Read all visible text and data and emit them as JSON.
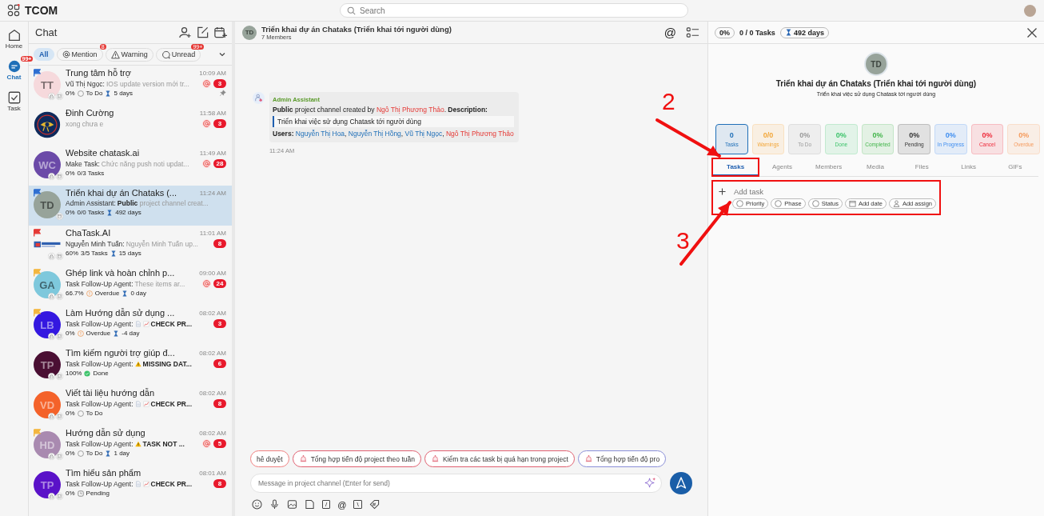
{
  "app": {
    "name": "TCOM",
    "search_placeholder": "Search"
  },
  "rail": [
    {
      "label": "Home",
      "kind": "home",
      "selected": false
    },
    {
      "label": "Chat",
      "kind": "chat",
      "selected": true,
      "badge": "99+"
    },
    {
      "label": "Task",
      "kind": "task",
      "selected": false
    }
  ],
  "chat_list": {
    "title": "Chat",
    "filters": [
      {
        "label": "All",
        "kind": "none",
        "selected": true
      },
      {
        "label": "Mention",
        "kind": "at",
        "selected": false,
        "badge": "8"
      },
      {
        "label": "Warning",
        "kind": "warning",
        "selected": false
      },
      {
        "label": "Unread",
        "kind": "unread",
        "selected": false,
        "badge": "99+"
      }
    ],
    "items": [
      {
        "name": "Trung tâm hỗ trợ",
        "time": "10:09 AM",
        "avatar": {
          "kind": "initials",
          "initials": "TT",
          "color": "#f6d9dc",
          "dark": false
        },
        "flag": {
          "color": "#2f6fd1"
        },
        "badges": [
          {
            "kind": "lock"
          },
          {
            "kind": "check"
          }
        ],
        "sender": "Vũ Thị Ngọc:",
        "preview": "IOS update version mới tr...",
        "meta": {
          "percent": "0%",
          "status": {
            "kind": "todo",
            "label": "To Do"
          },
          "days": "5 days"
        },
        "mention": true,
        "unread": "3",
        "pinned": true,
        "selected": false
      },
      {
        "name": "Đinh Cường",
        "time": "11:58 AM",
        "avatar": {
          "kind": "picture"
        },
        "preview": "xong chưa e",
        "mention": true,
        "unread": "3",
        "pinned": false,
        "selected": false
      },
      {
        "name": "Website chatask.ai",
        "time": "11:49 AM",
        "avatar": {
          "kind": "initials",
          "initials": "WC",
          "color": "#6b4aa8",
          "dark": true
        },
        "badges": [
          {
            "kind": "lock"
          },
          {
            "kind": "calendar"
          }
        ],
        "sender": "Make Task:",
        "preview": "Chức năng push noti updat...",
        "meta": {
          "percent": "0%",
          "tasks": "0/3 Tasks"
        },
        "mention": true,
        "unread": "28",
        "pinned": false,
        "selected": false
      },
      {
        "name": "Triển khai dự án Chataks (...",
        "time": "11:24 AM",
        "avatar": {
          "kind": "initials",
          "initials": "TD",
          "color": "#97a39a",
          "dark": false
        },
        "flag": {
          "color": "#2f6fd1"
        },
        "badges": [
          {
            "kind": "calendar"
          }
        ],
        "sender": "Admin Assistant:",
        "preview": "**Public** project channel creat...",
        "meta": {
          "percent": "0%",
          "tasks": "0/0 Tasks",
          "days": "492 days"
        },
        "mention": false,
        "pinned": false,
        "selected": true
      },
      {
        "name": "ChaTask.AI",
        "time": "11:01 AM",
        "avatar": {
          "kind": "logo"
        },
        "flag": {
          "color": "#e53935"
        },
        "badges": [
          {
            "kind": "lock"
          },
          {
            "kind": "calendar"
          }
        ],
        "sender": "Nguyễn Minh Tuấn:",
        "preview": "Nguyễn Minh Tuấn up...",
        "meta": {
          "percent": "60%",
          "tasks": "3/5 Tasks",
          "days": "15 days"
        },
        "mention": false,
        "unread": "8",
        "pinned": false,
        "selected": false
      },
      {
        "name": "Ghép link và hoàn chỉnh p...",
        "time": "09:00 AM",
        "avatar": {
          "kind": "initials",
          "initials": "GA",
          "color": "#7ec8dc",
          "dark": false
        },
        "flag": {
          "color": "#f3b63f"
        },
        "badges": [
          {
            "kind": "lock"
          },
          {
            "kind": "check"
          }
        ],
        "sender": "Task Follow-Up Agent:",
        "preview": "These items ar...",
        "meta": {
          "percent": "66.7%",
          "status": {
            "kind": "overdue",
            "label": "Overdue"
          },
          "days": "0 day"
        },
        "mention": true,
        "unread": "24",
        "pinned": false,
        "selected": false
      },
      {
        "name": "Làm Hướng dẫn sử dụng ...",
        "time": "08:02 AM",
        "avatar": {
          "kind": "initials",
          "initials": "LB",
          "color": "#3418e0",
          "dark": true
        },
        "flag": {
          "color": "#f3b63f"
        },
        "badges": [
          {
            "kind": "lock"
          },
          {
            "kind": "check"
          }
        ],
        "sender": "Task Follow-Up Agent:",
        "preview": "**CHECK PR...**",
        "preview_icons": [
          {
            "kind": "document"
          },
          {
            "kind": "chart"
          }
        ],
        "meta": {
          "percent": "0%",
          "status": {
            "kind": "overdue",
            "label": "Overdue"
          },
          "days": "-4 day"
        },
        "mention": false,
        "unread": "3",
        "pinned": false,
        "selected": false
      },
      {
        "name": "Tìm kiếm người trợ giúp đ...",
        "time": "08:02 AM",
        "avatar": {
          "kind": "initials",
          "initials": "TP",
          "color": "#4a0f33",
          "dark": true
        },
        "badges": [
          {
            "kind": "lock"
          },
          {
            "kind": "check"
          }
        ],
        "sender": "Task Follow-Up Agent:",
        "preview": "**MISSING DAT...**",
        "preview_icons": [
          {
            "kind": "warning"
          }
        ],
        "meta": {
          "percent": "100%",
          "status": {
            "kind": "done",
            "label": "Done"
          }
        },
        "mention": false,
        "unread": "6",
        "pinned": false,
        "selected": false
      },
      {
        "name": "Viết tài liệu hướng dẫn",
        "time": "08:02 AM",
        "avatar": {
          "kind": "initials",
          "initials": "VD",
          "color": "#f4622a",
          "dark": true
        },
        "badges": [
          {
            "kind": "lock"
          },
          {
            "kind": "check"
          }
        ],
        "sender": "Task Follow-Up Agent:",
        "preview": "**CHECK PR...**",
        "preview_icons": [
          {
            "kind": "document"
          },
          {
            "kind": "chart"
          }
        ],
        "meta": {
          "percent": "0%",
          "status": {
            "kind": "todo",
            "label": "To Do"
          }
        },
        "mention": false,
        "unread": "8",
        "pinned": false,
        "selected": false
      },
      {
        "name": "Hướng dẫn sử dụng",
        "time": "08:02 AM",
        "avatar": {
          "kind": "initials",
          "initials": "HD",
          "color": "#a98ab0",
          "dark": true
        },
        "flag": {
          "color": "#f3b63f"
        },
        "badges": [
          {
            "kind": "lock"
          },
          {
            "kind": "check"
          }
        ],
        "sender": "Task Follow-Up Agent:",
        "preview": "**TASK NOT ...**",
        "preview_icons": [
          {
            "kind": "warning"
          }
        ],
        "meta": {
          "percent": "0%",
          "status": {
            "kind": "todo",
            "label": "To Do"
          },
          "days": "1 day"
        },
        "mention": true,
        "unread": "5",
        "pinned": false,
        "selected": false
      },
      {
        "name": "Tìm hiểu sản phẩm",
        "time": "08:01 AM",
        "avatar": {
          "kind": "initials",
          "initials": "TP",
          "color": "#5a12c8",
          "dark": true
        },
        "badges": [
          {
            "kind": "lock"
          },
          {
            "kind": "check"
          }
        ],
        "sender": "Task Follow-Up Agent:",
        "preview": "**CHECK PR...**",
        "preview_icons": [
          {
            "kind": "document"
          },
          {
            "kind": "chart"
          }
        ],
        "meta": {
          "percent": "0%",
          "status": {
            "kind": "pending",
            "label": "Pending"
          }
        },
        "mention": false,
        "unread": "8",
        "pinned": false,
        "selected": false
      }
    ]
  },
  "channel": {
    "initials": "TD",
    "title": "Triển khai dự án Chataks (Triển khai tới người dùng)",
    "members": "7 Members",
    "mention_label": "@"
  },
  "message": {
    "sender": "Admin Assistant",
    "line_1": [
      {
        "kind": "bold",
        "text": "Public"
      },
      {
        "kind": "plain",
        "text": " project channel created by "
      },
      {
        "kind": "red",
        "text": "Ngô Thị Phương Thảo"
      },
      {
        "kind": "plain",
        "text": ". "
      },
      {
        "kind": "bold",
        "text": "Description:"
      }
    ],
    "quote": "Triển khai việc sử dụng Chatask tới người dùng",
    "line_2": [
      {
        "kind": "bold",
        "text": "Users: "
      },
      {
        "kind": "blue",
        "text": "Nguyễn Thị Hoa"
      },
      {
        "kind": "plain",
        "text": ", "
      },
      {
        "kind": "blue",
        "text": "Nguyễn Thị Hồng"
      },
      {
        "kind": "plain",
        "text": ", "
      },
      {
        "kind": "blue",
        "text": "Vũ Thị Ngọc"
      },
      {
        "kind": "plain",
        "text": ", "
      },
      {
        "kind": "red",
        "text": "Ngô Thị Phương Thảo"
      }
    ],
    "time": "11:24 AM"
  },
  "suggestions": [
    {
      "label": "hê duyệt",
      "color": "#f08080",
      "icon": false
    },
    {
      "label": "Tổng hợp tiến độ project theo tuần",
      "color": "#e06070",
      "icon": true
    },
    {
      "label": "Kiểm tra các task bị quá hạn trong project",
      "color": "#e06070",
      "icon": true
    },
    {
      "label": "Tổng hợp tiến độ pro",
      "color": "#8a8fd8",
      "icon": true
    }
  ],
  "composer": {
    "placeholder": "Message in project channel (Enter for send)",
    "tools": [
      {
        "kind": "emoji"
      },
      {
        "kind": "mic"
      },
      {
        "kind": "image"
      },
      {
        "kind": "file"
      },
      {
        "kind": "boxed",
        "label": "/"
      },
      {
        "kind": "text",
        "label": "@"
      },
      {
        "kind": "boxed",
        "label": "\\"
      },
      {
        "kind": "tag"
      }
    ]
  },
  "details": {
    "percent": "0%",
    "tasks": "0 / 0 Tasks",
    "days": "492 days",
    "initials": "TD",
    "title": "Triển khai dự án Chataks (Triển khai tới người dùng)",
    "description": "Triển khai việc sử dụng Chatask tới người dùng",
    "stats": [
      {
        "value": "0",
        "label": "Tasks",
        "color": "#1f6fb8",
        "selected": true
      },
      {
        "value": "0/0",
        "label": "Warnings",
        "color": "#f3a73a",
        "selected": false
      },
      {
        "value": "0%",
        "label": "To Do",
        "color": "#999999",
        "selected": false
      },
      {
        "value": "0%",
        "label": "Done",
        "color": "#3cc36a",
        "selected": false
      },
      {
        "value": "0%",
        "label": "Completed",
        "color": "#42b54a",
        "selected": false
      },
      {
        "value": "0%",
        "label": "Pending",
        "color": "#333333",
        "selected": false
      },
      {
        "value": "0%",
        "label": "In Progress",
        "color": "#3f8ef0",
        "selected": false
      },
      {
        "value": "0%",
        "label": "Cancel",
        "color": "#ee2a3a",
        "selected": false
      },
      {
        "value": "0%",
        "label": "Overdue",
        "color": "#f59a5c",
        "selected": false
      }
    ],
    "tabs": [
      {
        "label": "Tasks",
        "selected": true,
        "highlighted": true
      },
      {
        "label": "Agents",
        "selected": false,
        "highlighted": false
      },
      {
        "label": "Members",
        "selected": false,
        "highlighted": false
      },
      {
        "label": "Media",
        "selected": false,
        "highlighted": false
      },
      {
        "label": "Files",
        "selected": false,
        "highlighted": false
      },
      {
        "label": "Links",
        "selected": false,
        "highlighted": false
      },
      {
        "label": "GIFs",
        "selected": false,
        "highlighted": false
      }
    ],
    "add_task": {
      "placeholder": "Add task",
      "highlighted": true,
      "chips": [
        {
          "kind": "circle",
          "label": "Priority"
        },
        {
          "kind": "circle",
          "label": "Phase"
        },
        {
          "kind": "circle",
          "label": "Status"
        },
        {
          "kind": "calendar",
          "label": "Add date"
        },
        {
          "kind": "person",
          "label": "Add assign"
        }
      ]
    }
  },
  "annotations": [
    {
      "label": "2",
      "kind": "tabs"
    },
    {
      "label": "3",
      "kind": "add-task"
    }
  ]
}
